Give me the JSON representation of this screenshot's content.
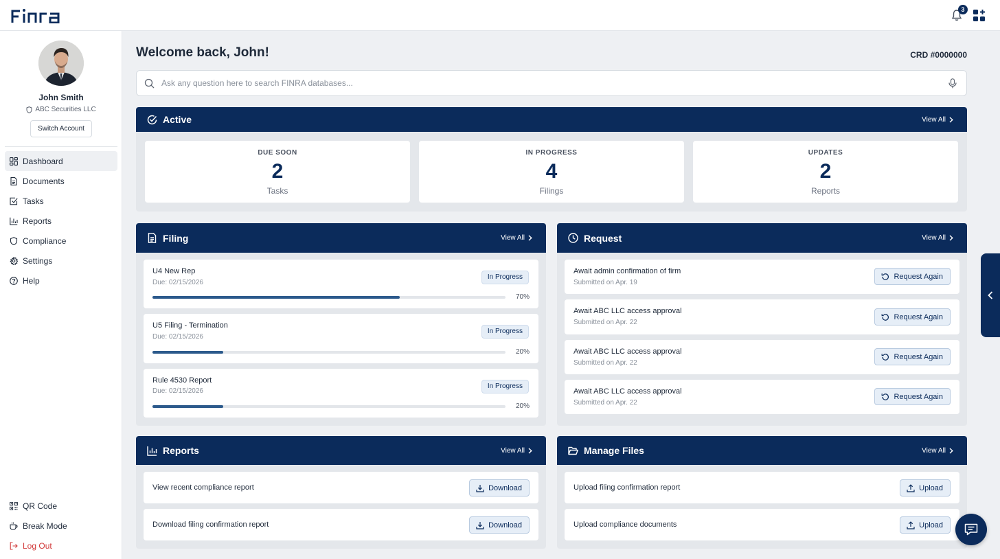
{
  "brand": {
    "logo_text": "FINRA",
    "accent": "#0b2b5b"
  },
  "header": {
    "notification_count": "3",
    "icons": [
      "bell-icon",
      "apps-grid-icon"
    ]
  },
  "user": {
    "name": "John Smith",
    "firm": "ABC Securities LLC",
    "switch_label": "Switch Account"
  },
  "nav": {
    "items": [
      {
        "label": "Dashboard",
        "icon": "dashboard-icon",
        "active": true
      },
      {
        "label": "Documents",
        "icon": "document-icon"
      },
      {
        "label": "Tasks",
        "icon": "tasks-icon"
      },
      {
        "label": "Reports",
        "icon": "chart-icon"
      },
      {
        "label": "Compliance",
        "icon": "shield-icon"
      },
      {
        "label": "Settings",
        "icon": "gear-icon"
      },
      {
        "label": "Help",
        "icon": "help-icon"
      }
    ],
    "bottom": [
      {
        "label": "QR Code",
        "icon": "qr-code-icon"
      },
      {
        "label": "Break Mode",
        "icon": "coffee-icon"
      },
      {
        "label": "Log Out",
        "icon": "logout-icon",
        "color": "#d23b3b"
      }
    ]
  },
  "main": {
    "welcome": "Welcome back, John!",
    "crd": "CRD #0000000",
    "search_placeholder": "Ask any question here to search FINRA databases..."
  },
  "active": {
    "title": "Active",
    "view_all": "View All",
    "stats": [
      {
        "label": "DUE SOON",
        "value": "2",
        "unit": "Tasks"
      },
      {
        "label": "IN PROGRESS",
        "value": "4",
        "unit": "Filings"
      },
      {
        "label": "UPDATES",
        "value": "2",
        "unit": "Reports"
      }
    ]
  },
  "filing": {
    "title": "Filing",
    "view_all": "View All",
    "items": [
      {
        "name": "U4 New Rep",
        "due": "Due: 02/15/2026",
        "status": "In Progress",
        "progress": 70,
        "progress_label": "70%"
      },
      {
        "name": "U5 Filing - Termination",
        "due": "Due: 02/15/2026",
        "status": "In Progress",
        "progress": 20,
        "progress_label": "20%"
      },
      {
        "name": "Rule 4530 Report",
        "due": "Due: 02/15/2026",
        "status": "In Progress",
        "progress": 20,
        "progress_label": "20%"
      }
    ]
  },
  "request": {
    "title": "Request",
    "view_all": "View All",
    "action_label": "Request Again",
    "items": [
      {
        "name": "Await admin confirmation of firm",
        "submitted": "Submitted on Apr. 19"
      },
      {
        "name": "Await ABC LLC access approval",
        "submitted": "Submitted on Apr. 22"
      },
      {
        "name": "Await ABC LLC access approval",
        "submitted": "Submitted on Apr. 22"
      },
      {
        "name": "Await ABC LLC access approval",
        "submitted": "Submitted on Apr. 22"
      }
    ]
  },
  "reports": {
    "title": "Reports",
    "view_all": "View All",
    "action_label": "Download",
    "items": [
      {
        "name": "View recent compliance report"
      },
      {
        "name": "Download filing confirmation report"
      }
    ]
  },
  "files": {
    "title": "Manage Files",
    "view_all": "View All",
    "action_label": "Upload",
    "items": [
      {
        "name": "Upload filing confirmation report"
      },
      {
        "name": "Upload compliance documents"
      }
    ]
  }
}
